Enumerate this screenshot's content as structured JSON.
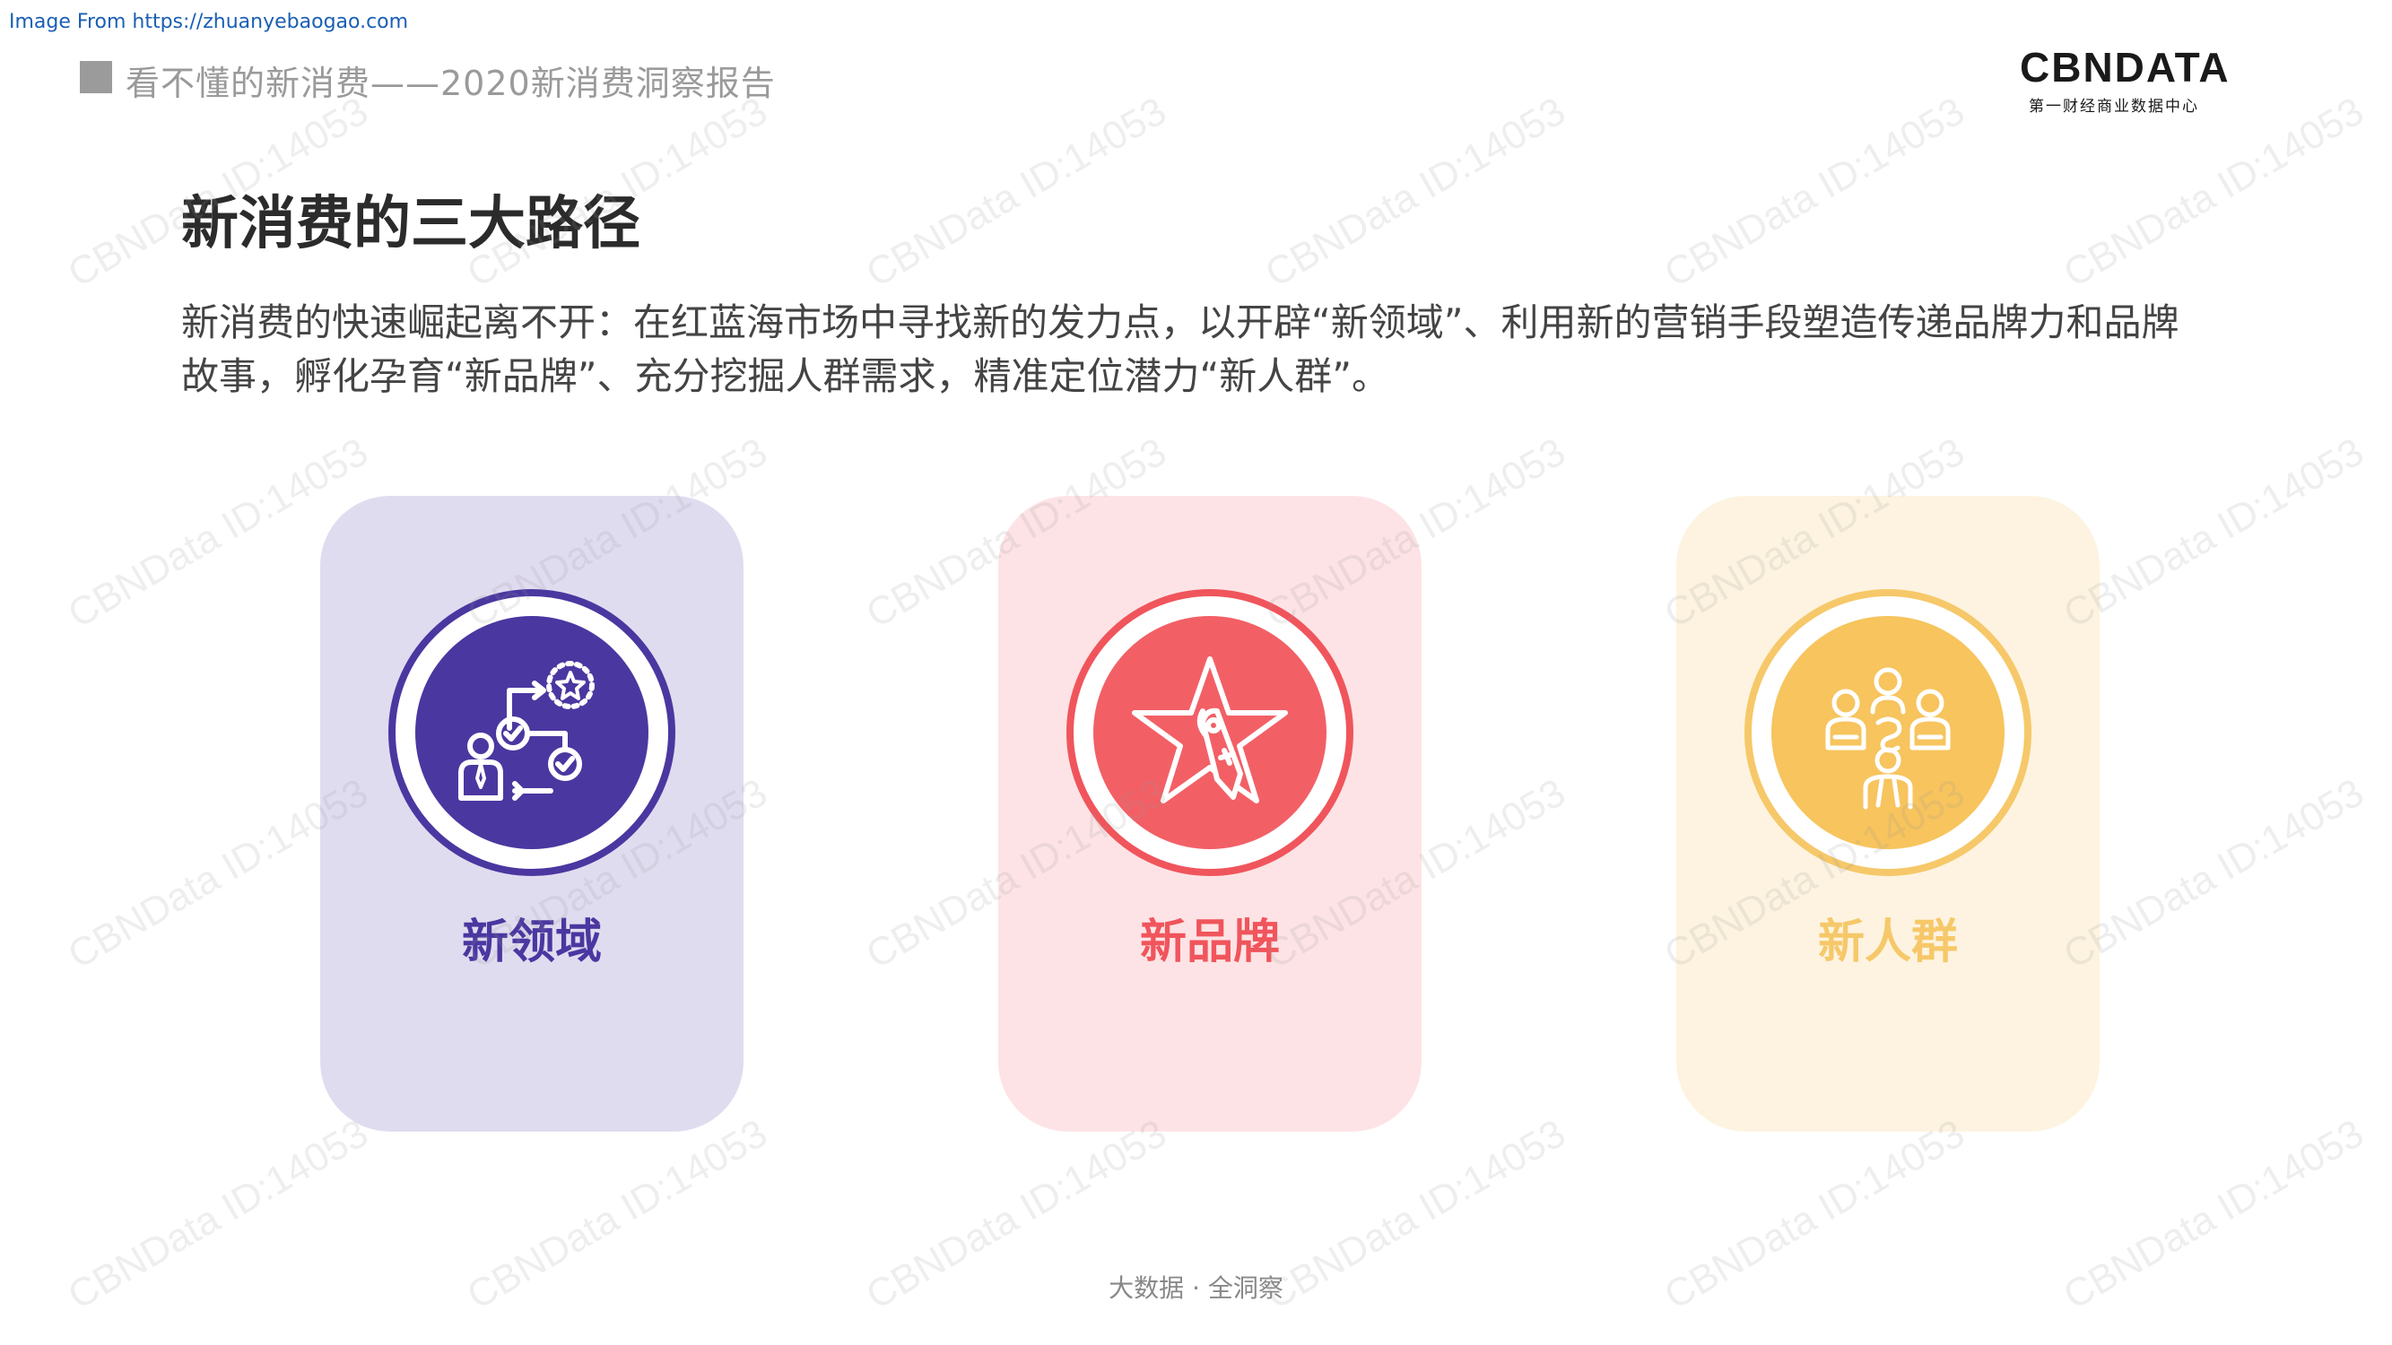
{
  "source_note": "Image From https://zhuanyebaogao.com",
  "header": {
    "report_title": "看不懂的新消费——2020新消费洞察报告"
  },
  "logo": {
    "name": "CBNDATA",
    "subtitle": "第一财经商业数据中心"
  },
  "section": {
    "title": "新消费的三大路径",
    "intro": "新消费的快速崛起离不开：在红蓝海市场中寻找新的发力点，以开辟“新领域”、利用新的营销手段塑造传递品牌力和品牌故事，孵化孕育“新品牌”、充分挖掘人群需求，精准定位潜力“新人群”。"
  },
  "cards": [
    {
      "label": "新领域",
      "icon": "workflow-person-icon",
      "color": "#4b37a0"
    },
    {
      "label": "新品牌",
      "icon": "star-tag-icon",
      "color": "#f0555c"
    },
    {
      "label": "新人群",
      "icon": "people-group-icon",
      "color": "#f6c869"
    }
  ],
  "footer": "大数据 · 全洞察",
  "watermark": "CBNData ID:14053"
}
